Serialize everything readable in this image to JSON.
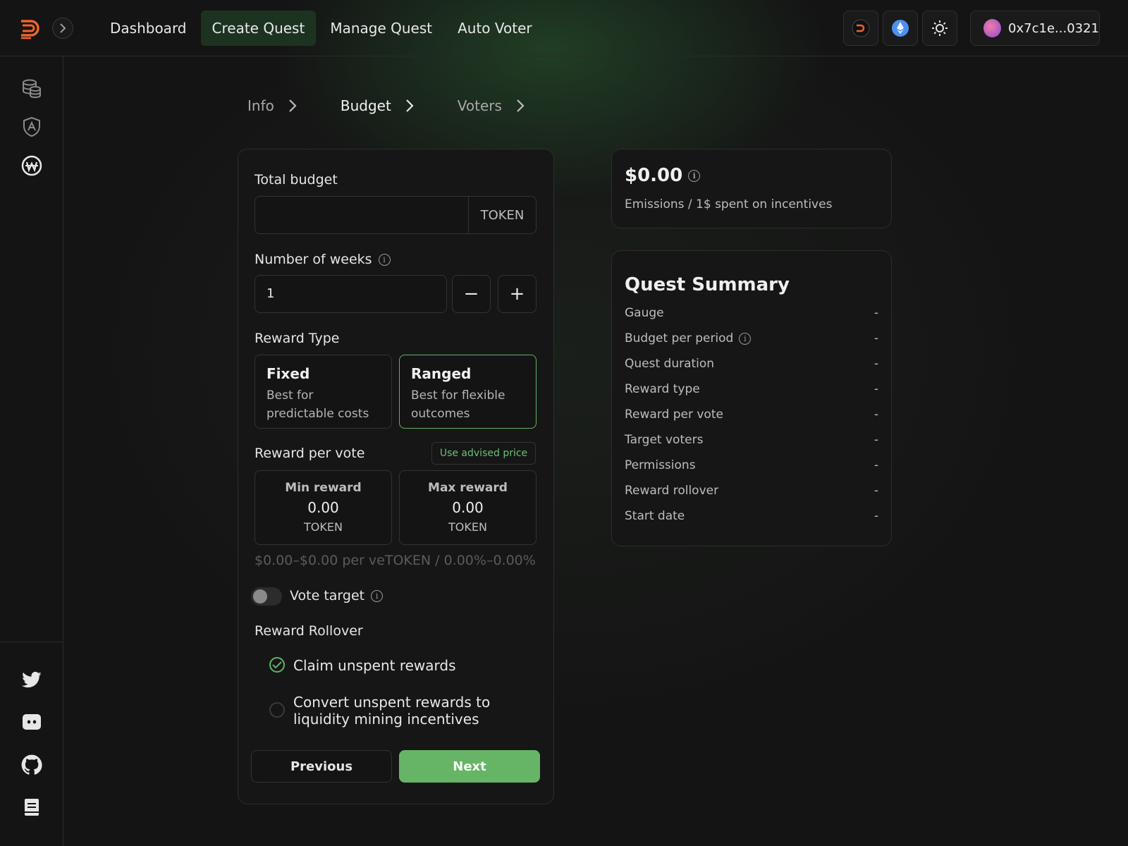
{
  "nav": {
    "items": [
      {
        "label": "Dashboard"
      },
      {
        "label": "Create Quest"
      },
      {
        "label": "Manage Quest"
      },
      {
        "label": "Auto Voter"
      }
    ],
    "active": "Create Quest"
  },
  "wallet": {
    "address": "0x7c1e...0321"
  },
  "steps": [
    {
      "label": "Info"
    },
    {
      "label": "Budget"
    },
    {
      "label": "Voters"
    }
  ],
  "form": {
    "total_budget": {
      "label": "Total budget",
      "value": "",
      "suffix": "TOKEN"
    },
    "weeks": {
      "label": "Number of weeks",
      "value": "1",
      "minus": "−",
      "plus": "+"
    },
    "reward_type": {
      "label": "Reward Type",
      "options": [
        {
          "title": "Fixed",
          "desc": "Best for predictable costs"
        },
        {
          "title": "Ranged",
          "desc": "Best for flexible outcomes"
        }
      ],
      "selected": "Ranged"
    },
    "reward_per_vote": {
      "label": "Reward per vote",
      "advised_button": "Use advised price",
      "min": {
        "title": "Min reward",
        "value": "0.00",
        "unit": "TOKEN"
      },
      "max": {
        "title": "Max reward",
        "value": "0.00",
        "unit": "TOKEN"
      },
      "summary_line": "$0.00–$0.00 per veTOKEN / 0.00%–0.00%"
    },
    "vote_target": {
      "label": "Vote target",
      "enabled": false
    },
    "rollover": {
      "label": "Reward Rollover",
      "options": [
        {
          "label": "Claim unspent rewards",
          "checked": true
        },
        {
          "label": "Convert unspent rewards to liquidity mining incentives",
          "checked": false
        }
      ]
    },
    "buttons": {
      "previous": "Previous",
      "next": "Next"
    }
  },
  "emissions": {
    "value": "$0.00",
    "caption": "Emissions / 1$ spent on incentives"
  },
  "summary": {
    "title": "Quest Summary",
    "rows": [
      {
        "key": "Gauge",
        "value": "-"
      },
      {
        "key": "Budget per period",
        "value": "-"
      },
      {
        "key": "Quest duration",
        "value": "-"
      },
      {
        "key": "Reward type",
        "value": "-"
      },
      {
        "key": "Reward per vote",
        "value": "-"
      },
      {
        "key": "Target voters",
        "value": "-"
      },
      {
        "key": "Permissions",
        "value": "-"
      },
      {
        "key": "Reward rollover",
        "value": "-"
      },
      {
        "key": "Start date",
        "value": "-"
      }
    ]
  },
  "colors": {
    "accent": "#66b566",
    "background": "#141414",
    "active_nav": "#1d3322"
  }
}
